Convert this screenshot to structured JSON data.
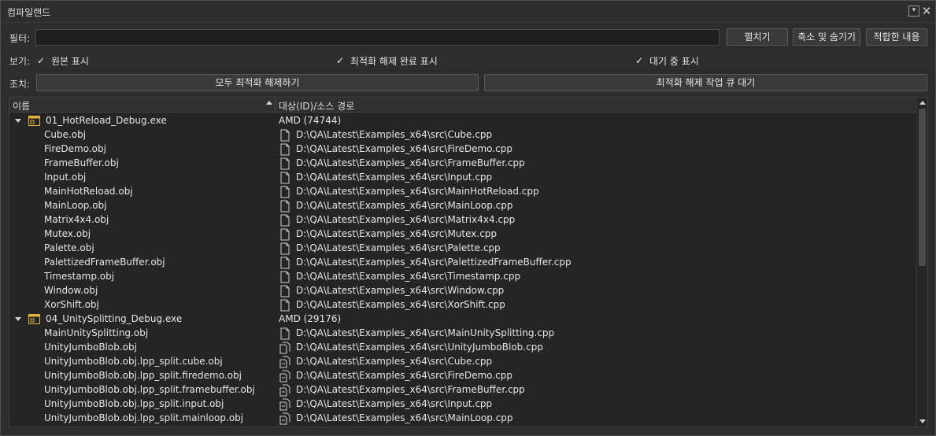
{
  "window": {
    "title": "컴파일랜드"
  },
  "filter": {
    "label": "필터:",
    "value": "",
    "placeholder": ""
  },
  "buttons": {
    "expand": "펼치기",
    "collapse_hide": "축소 및 숨기기",
    "fit_content": "적합한 내용"
  },
  "view": {
    "label": "보기:",
    "options": [
      {
        "label": "원본 표시",
        "checked": true
      },
      {
        "label": "최적화 해제 완료 표시",
        "checked": true
      },
      {
        "label": "대기 중 표시",
        "checked": true
      }
    ]
  },
  "actions": {
    "label": "조치:",
    "deopt_all": "모두 최적화 해제하기",
    "queue_deopt": "최적화 해제 작업 큐 대기"
  },
  "columns": {
    "name": "이름",
    "target": "대상(ID)/소스 경로"
  },
  "tree": [
    {
      "kind": "group",
      "name": "01_HotReload_Debug.exe",
      "target": "AMD (74744)"
    },
    {
      "kind": "item",
      "icon": "file-icon",
      "name": "Cube.obj",
      "path": "D:\\QA\\Latest\\Examples_x64\\src\\Cube.cpp"
    },
    {
      "kind": "item",
      "icon": "file-icon",
      "name": "FireDemo.obj",
      "path": "D:\\QA\\Latest\\Examples_x64\\src\\FireDemo.cpp"
    },
    {
      "kind": "item",
      "icon": "file-icon",
      "name": "FrameBuffer.obj",
      "path": "D:\\QA\\Latest\\Examples_x64\\src\\FrameBuffer.cpp"
    },
    {
      "kind": "item",
      "icon": "file-icon",
      "name": "Input.obj",
      "path": "D:\\QA\\Latest\\Examples_x64\\src\\Input.cpp"
    },
    {
      "kind": "item",
      "icon": "file-icon",
      "name": "MainHotReload.obj",
      "path": "D:\\QA\\Latest\\Examples_x64\\src\\MainHotReload.cpp"
    },
    {
      "kind": "item",
      "icon": "file-icon",
      "name": "MainLoop.obj",
      "path": "D:\\QA\\Latest\\Examples_x64\\src\\MainLoop.cpp"
    },
    {
      "kind": "item",
      "icon": "file-icon",
      "name": "Matrix4x4.obj",
      "path": "D:\\QA\\Latest\\Examples_x64\\src\\Matrix4x4.cpp"
    },
    {
      "kind": "item",
      "icon": "file-icon",
      "name": "Mutex.obj",
      "path": "D:\\QA\\Latest\\Examples_x64\\src\\Mutex.cpp"
    },
    {
      "kind": "item",
      "icon": "file-icon",
      "name": "Palette.obj",
      "path": "D:\\QA\\Latest\\Examples_x64\\src\\Palette.cpp"
    },
    {
      "kind": "item",
      "icon": "file-icon",
      "name": "PalettizedFrameBuffer.obj",
      "path": "D:\\QA\\Latest\\Examples_x64\\src\\PalettizedFrameBuffer.cpp"
    },
    {
      "kind": "item",
      "icon": "file-icon",
      "name": "Timestamp.obj",
      "path": "D:\\QA\\Latest\\Examples_x64\\src\\Timestamp.cpp"
    },
    {
      "kind": "item",
      "icon": "file-icon",
      "name": "Window.obj",
      "path": "D:\\QA\\Latest\\Examples_x64\\src\\Window.cpp"
    },
    {
      "kind": "item",
      "icon": "file-icon",
      "name": "XorShift.obj",
      "path": "D:\\QA\\Latest\\Examples_x64\\src\\XorShift.cpp"
    },
    {
      "kind": "group",
      "name": "04_UnitySplitting_Debug.exe",
      "target": "AMD (29176)"
    },
    {
      "kind": "item",
      "icon": "file-icon",
      "name": "MainUnitySplitting.obj",
      "path": "D:\\QA\\Latest\\Examples_x64\\src\\MainUnitySplitting.cpp"
    },
    {
      "kind": "item",
      "icon": "multi-file-icon",
      "name": "UnityJumboBlob.obj",
      "path": "D:\\QA\\Latest\\Examples_x64\\src\\UnityJumboBlob.cpp"
    },
    {
      "kind": "item",
      "icon": "split-file-icon",
      "name": "UnityJumboBlob.obj.lpp_split.cube.obj",
      "path": "D:\\QA\\Latest\\Examples_x64\\src\\Cube.cpp"
    },
    {
      "kind": "item",
      "icon": "split-file-icon",
      "name": "UnityJumboBlob.obj.lpp_split.firedemo.obj",
      "path": "D:\\QA\\Latest\\Examples_x64\\src\\FireDemo.cpp"
    },
    {
      "kind": "item",
      "icon": "split-file-icon",
      "name": "UnityJumboBlob.obj.lpp_split.framebuffer.obj",
      "path": "D:\\QA\\Latest\\Examples_x64\\src\\FrameBuffer.cpp"
    },
    {
      "kind": "item",
      "icon": "split-file-icon",
      "name": "UnityJumboBlob.obj.lpp_split.input.obj",
      "path": "D:\\QA\\Latest\\Examples_x64\\src\\Input.cpp"
    },
    {
      "kind": "item",
      "icon": "split-file-icon",
      "name": "UnityJumboBlob.obj.lpp_split.mainloop.obj",
      "path": "D:\\QA\\Latest\\Examples_x64\\src\\MainLoop.cpp"
    }
  ]
}
